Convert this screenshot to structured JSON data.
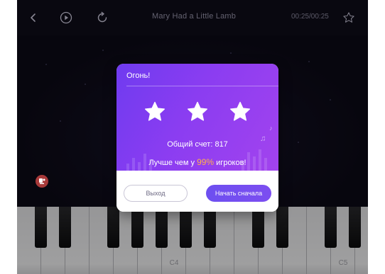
{
  "topbar": {
    "song_title": "Mary Had a Little Lamb",
    "time": "00:25/00:25",
    "icons": [
      "chevron-left-icon",
      "play-icon",
      "replay-icon",
      "star-outline-icon"
    ]
  },
  "keyboard": {
    "labels": [
      "C4",
      "C5"
    ]
  },
  "modal": {
    "title": "Огонь!",
    "stars_earned": 3,
    "stars_total": 3,
    "score_text": "Общий счет: 817",
    "better_prefix": "Лучше чем у ",
    "better_percent": "99%",
    "better_suffix": " игроков!",
    "exit_label": "Выход",
    "restart_label": "Начать сначала"
  },
  "colors": {
    "accent": "#7a4ef0",
    "highlight": "#ffb14a",
    "header_gradient_start": "#6f3bf0",
    "header_gradient_end": "#a243ee"
  }
}
